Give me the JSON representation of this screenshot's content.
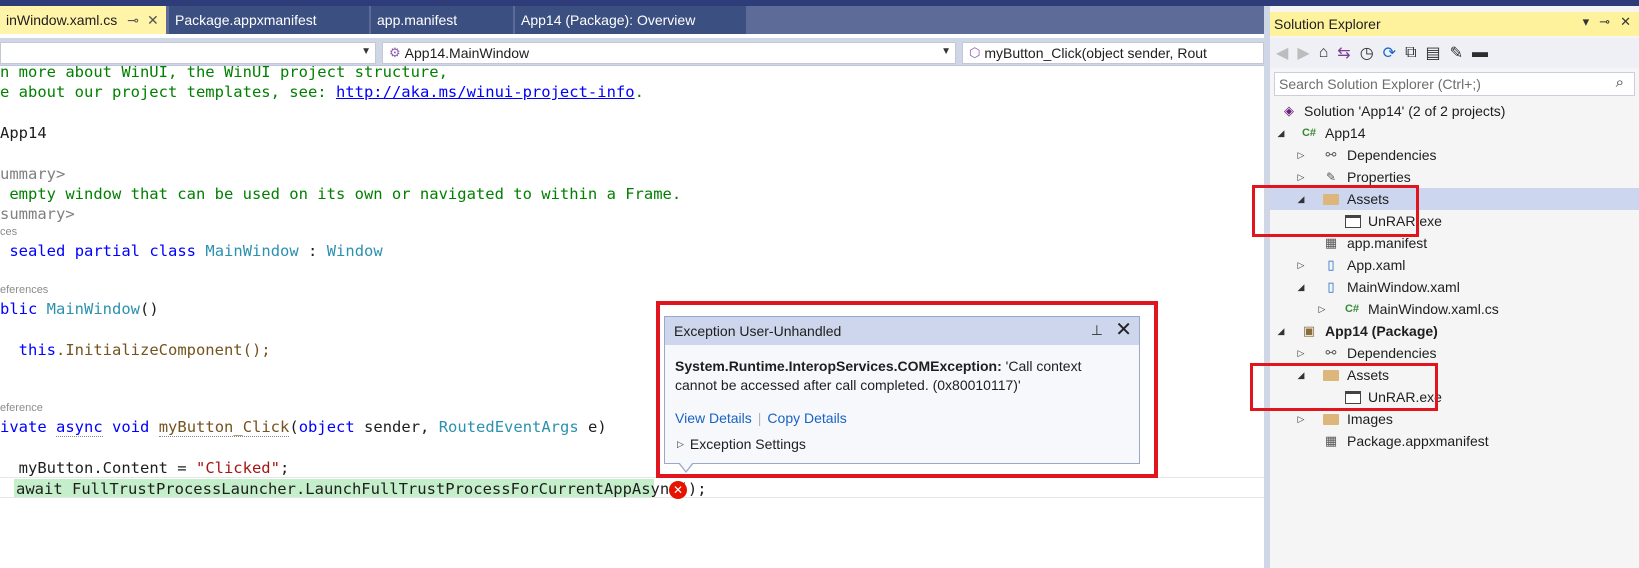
{
  "tabs": [
    {
      "label": "inWindow.xaml.cs",
      "active": true,
      "pin_icon": "pin-icon",
      "close_icon": "close-icon"
    },
    {
      "label": "Package.appxmanifest",
      "active": false
    },
    {
      "label": "app.manifest",
      "active": false
    },
    {
      "label": "App14 (Package): Overview",
      "active": false
    }
  ],
  "nav": {
    "class_combo": "App14.MainWindow",
    "member_combo": "myButton_Click(object sender, Rout"
  },
  "code": {
    "line1_comment": "n more about WinUI, the WinUI project structure,",
    "line2_comment": "e about our project templates, see: ",
    "line2_link": "http://aka.ms/winui-project-info",
    "line2_tail": ".",
    "namespace": "App14",
    "summary_open": "ummary>",
    "summary_text": " empty window that can be used on its own or navigated to within a Frame.",
    "summary_close": "summary>",
    "lens1": "ces",
    "class_kw1": "sealed",
    "class_kw2": "partial",
    "class_kw3": "class",
    "class_name": "MainWindow",
    "class_colon": " : ",
    "class_base": "Window",
    "lens2": "eferences",
    "ctor_kw": "blic",
    "ctor_name": "MainWindow",
    "ctor_parens": "()",
    "init_this": "this",
    "init_call": ".InitializeComponent();",
    "lens3": "eference",
    "m_kw1": "ivate",
    "m_kw2": "async",
    "m_kw3": "void",
    "m_name": "myButton_Click",
    "m_p1": "(",
    "m_kw4": "object",
    "m_p2": " sender, ",
    "m_type": "RoutedEventArgs",
    "m_p3": " e)",
    "content_left": "myButton.Content = ",
    "content_str": "\"Clicked\"",
    "content_end": ";",
    "await_line": "await FullTrustProcessLauncher.LaunchFullTrustProcessForCurrentAppAsync();"
  },
  "exception": {
    "title": "Exception User-Unhandled",
    "type": "System.Runtime.InteropServices.COMException:",
    "message": " 'Call context cannot be accessed after call completed. (0x80010117)'",
    "view_details": "View Details",
    "copy_details": "Copy Details",
    "settings": "Exception Settings"
  },
  "solution_explorer": {
    "title": "Solution Explorer",
    "search_placeholder": "Search Solution Explorer (Ctrl+;)",
    "items": [
      {
        "label": "Solution 'App14' (2 of 2 projects)",
        "icon": "solution-icon",
        "bold": false
      },
      {
        "label": "App14",
        "icon": "csharp-project-icon",
        "bold": false
      },
      {
        "label": "Dependencies",
        "icon": "dependencies-icon",
        "bold": false
      },
      {
        "label": "Properties",
        "icon": "wrench-icon",
        "bold": false
      },
      {
        "label": "Assets",
        "icon": "folder-open-icon",
        "bold": false,
        "selected": true
      },
      {
        "label": "UnRAR.exe",
        "icon": "exe-file-icon",
        "bold": false
      },
      {
        "label": "app.manifest",
        "icon": "manifest-icon",
        "bold": false
      },
      {
        "label": "App.xaml",
        "icon": "xaml-icon",
        "bold": false
      },
      {
        "label": "MainWindow.xaml",
        "icon": "xaml-icon",
        "bold": false
      },
      {
        "label": "MainWindow.xaml.cs",
        "icon": "csharp-file-icon",
        "bold": false
      },
      {
        "label": "App14 (Package)",
        "icon": "package-project-icon",
        "bold": true
      },
      {
        "label": "Dependencies",
        "icon": "dependencies-icon",
        "bold": false
      },
      {
        "label": "Assets",
        "icon": "folder-open-icon",
        "bold": false
      },
      {
        "label": "UnRAR.exe",
        "icon": "exe-file-icon",
        "bold": false
      },
      {
        "label": "Images",
        "icon": "folder-icon",
        "bold": false
      },
      {
        "label": "Package.appxmanifest",
        "icon": "manifest-icon",
        "bold": false
      }
    ]
  },
  "colors": {
    "tab_active": "#fff4a8",
    "tab_inactive": "#3b4f81",
    "highlight_red": "#e0151e",
    "error_icon": "#e51400",
    "link_blue": "#1a62c2"
  }
}
